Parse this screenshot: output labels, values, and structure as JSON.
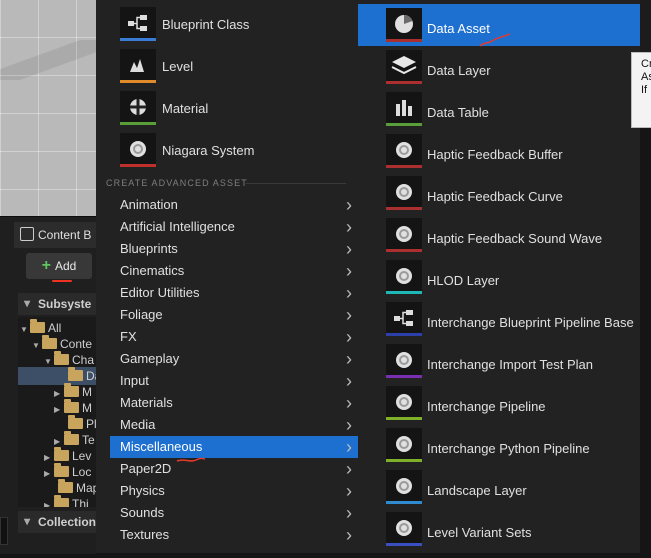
{
  "content_browser": {
    "tab_label": "Content B",
    "add_label": "Add",
    "subsystems_label": "Subsyste",
    "collections_label": "Collection",
    "tree": [
      {
        "label": "All"
      },
      {
        "label": "Conte"
      },
      {
        "label": "Cha"
      },
      {
        "label": "Da"
      },
      {
        "label": "M"
      },
      {
        "label": "M"
      },
      {
        "label": "Pl"
      },
      {
        "label": "Te"
      },
      {
        "label": "Lev"
      },
      {
        "label": "Loc"
      },
      {
        "label": "Map"
      },
      {
        "label": "Thi"
      }
    ]
  },
  "basic_assets": [
    {
      "label": "Blueprint Class",
      "icon": "blueprint-icon",
      "color": "#3a7bd5"
    },
    {
      "label": "Level",
      "icon": "level-icon",
      "color": "#e08a2a"
    },
    {
      "label": "Material",
      "icon": "material-icon",
      "color": "#5a9e3a"
    },
    {
      "label": "Niagara System",
      "icon": "niagara-icon",
      "color": "#c0302a"
    }
  ],
  "advanced_header": "CREATE ADVANCED ASSET",
  "categories": [
    "Animation",
    "Artificial Intelligence",
    "Blueprints",
    "Cinematics",
    "Editor Utilities",
    "Foliage",
    "FX",
    "Gameplay",
    "Input",
    "Materials",
    "Media",
    "Miscellaneous",
    "Paper2D",
    "Physics",
    "Sounds",
    "Textures"
  ],
  "selected_category": "Miscellaneous",
  "misc_assets": [
    {
      "label": "Data Asset",
      "icon": "pie-chart-icon",
      "color": "#aa2f2f"
    },
    {
      "label": "Data Layer",
      "icon": "layers-icon",
      "color": "#aa2f2f"
    },
    {
      "label": "Data Table",
      "icon": "table-icon",
      "color": "#5a9e3a"
    },
    {
      "label": "Haptic Feedback Buffer",
      "icon": "sphere-icon",
      "color": "#aa2f2f"
    },
    {
      "label": "Haptic Feedback Curve",
      "icon": "sphere-icon",
      "color": "#aa2f2f"
    },
    {
      "label": "Haptic Feedback Sound Wave",
      "icon": "sphere-icon",
      "color": "#aa2f2f"
    },
    {
      "label": "HLOD Layer",
      "icon": "sphere-icon",
      "color": "#1fb6b6"
    },
    {
      "label": "Interchange Blueprint Pipeline Base",
      "icon": "blueprint-icon",
      "color": "#2d3fa8"
    },
    {
      "label": "Interchange Import Test Plan",
      "icon": "sphere-icon",
      "color": "#7a2fb0"
    },
    {
      "label": "Interchange Pipeline",
      "icon": "sphere-icon",
      "color": "#7fb02a"
    },
    {
      "label": "Interchange Python Pipeline",
      "icon": "sphere-icon",
      "color": "#7fb02a"
    },
    {
      "label": "Landscape Layer",
      "icon": "sphere-icon",
      "color": "#2f8ad0"
    },
    {
      "label": "Level Variant Sets",
      "icon": "sphere-icon",
      "color": "#3a4fc0"
    }
  ],
  "selected_asset": "Data Asset",
  "tooltip": [
    "Cr",
    "As",
    "If"
  ]
}
